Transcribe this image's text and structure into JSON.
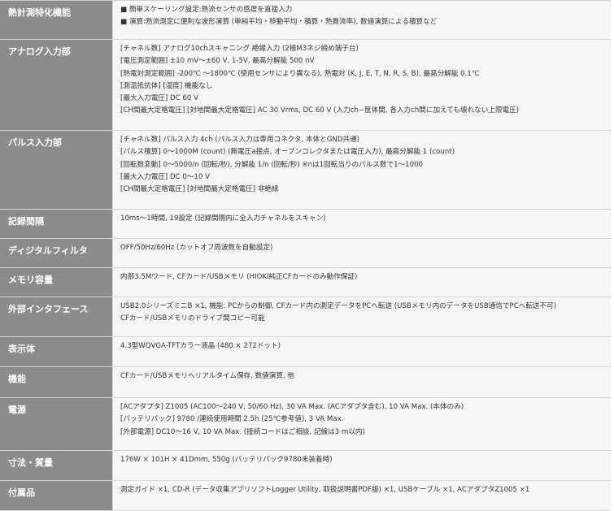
{
  "spec_table": {
    "rows": [
      {
        "header": "熱計測特化機能",
        "lines": [
          "■ 簡単スケーリング設定:熱流センサの感度を直接入力",
          "■ 演算:熱流測定に便利な波形演算 (単純平均・移動平均・積算・熱貫流率), 数値演算による積算など"
        ]
      },
      {
        "header": "アナログ入力部",
        "lines": [
          "[チャネル数] アナログ10chスキャニング 絶縁入力 (2極M3ネジ締め端子台)",
          "[電圧測定範囲] ±10 mV〜±60 V, 1-5V, 最高分解能 500 nV",
          "[熱電対測定範囲] -200℃ 〜1800℃ (使用センサにより異なる), 熱電対 (K, J, E, T, N, R, S, B), 最高分解能 0.1℃",
          "[測温抵抗体] [湿度] 機能なし",
          "[最大入力電圧] DC 60 V",
          "[CH間最大定格電圧] [対地間最大定格電圧] AC 30 Vrms, DC 60 V (入力ch−筐体間, 各入力ch間に加えても壊れない上限電圧)"
        ]
      },
      {
        "header": "パルス入力部",
        "lines": [
          "[チャネル数] パルス入力 4ch (パルス入力は専用コネクタ, 本体とGND共通)",
          "[パルス積算] 0〜1000M (count) (無電圧a接点, オープンコレクタまたは電圧入力), 最高分解能 1 (count)",
          "[回転数変動] 0〜5000/n (回転/秒), 分解能 1/n (回転/秒) ※nは1回転当りのパルス数で1〜1000",
          "[最大入力電圧] DC 0〜10 V",
          "[CH間最大定格電圧] [対地間最大定格電圧] 非絶縁"
        ]
      },
      {
        "header": "記録間隔",
        "lines": [
          "10ms〜1時間, 19設定 (記録間隔内に全入力チャネルをスキャン)"
        ]
      },
      {
        "header": "ディジタルフィルタ",
        "lines": [
          "OFF/50Hz/60Hz (カットオフ周波数を自動設定)"
        ]
      },
      {
        "header": "メモリ容量",
        "lines": [
          "内部3.5Mワード, CFカード/USBメモリ (HIOKI純正CFカードのみ動作保証)"
        ]
      },
      {
        "header": "外部インタフェース",
        "lines": [
          "USB2.0シリーズミニB ×1, 機能: PCからの制御, CFカード内の測定データをPCへ転送 (USBメモリ内のデータをUSB通信でPCへ転送不可)",
          "CFカード/USBメモリのドライブ間コピー可能"
        ]
      },
      {
        "header": "表示体",
        "lines": [
          "4.3型WQVGA-TFTカラー液晶 (480 × 272ドット)"
        ]
      },
      {
        "header": "機能",
        "lines": [
          "CFカード/USBメモリへリアルタイム保存, 数値演算, 他"
        ]
      },
      {
        "header": "電源",
        "lines": [
          "[ACアダプタ] Z1005 (AC100〜240 V, 50/60 Hz), 30 VA Max. (ACアダプタ含む), 10 VA Max. (本体のみ)",
          "[バッテリパック] 9780 /連続使用時間 2.5h (25℃参考値), 3 VA Max.",
          "[外部電源] DC10〜16 V, 10 VA Max. (接続コードはご相談, 記線は3 m以内)"
        ]
      },
      {
        "header": "寸法・質量",
        "lines": [
          "176W × 101H × 41Dmm, 550g (バッテリパック9780未装着時)"
        ]
      },
      {
        "header": "付属品",
        "lines": [
          "測定ガイド ×1, CD-R (データ収集アプリソフトLogger Utility, 取扱説明書PDF版) ×1, USBケーブル ×1, ACアダプタZ1005 ×1"
        ]
      }
    ]
  }
}
